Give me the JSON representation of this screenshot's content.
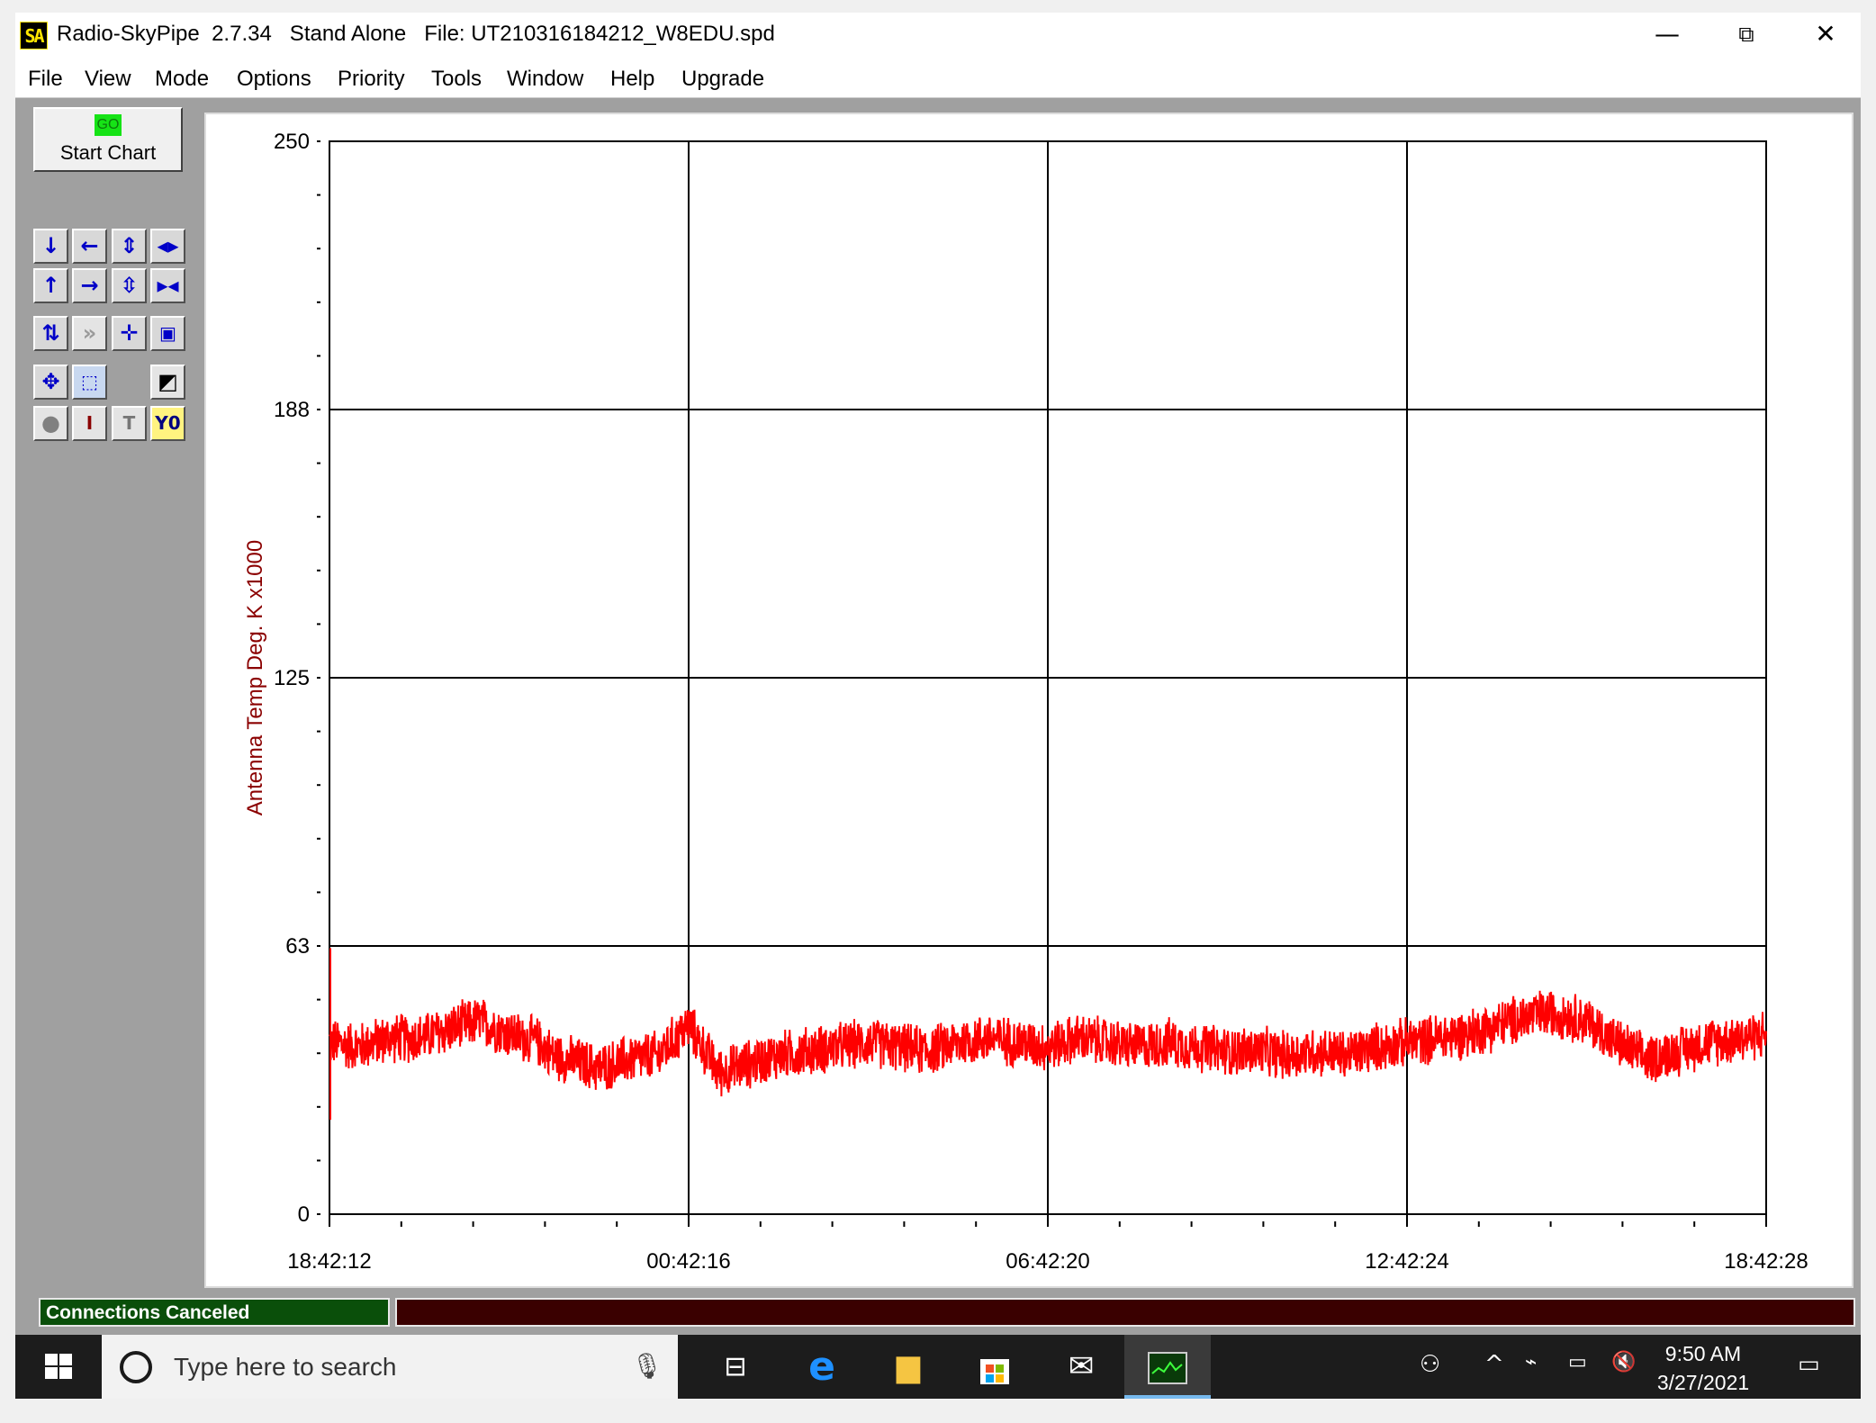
{
  "titlebar": {
    "icon_text": "SA",
    "title": "Radio-SkyPipe  2.7.34   Stand Alone   File: UT210316184212_W8EDU.spd",
    "minimize": "—",
    "restore": "⧉",
    "close": "✕"
  },
  "menu": [
    "File",
    "View",
    "Mode",
    "Options",
    "Priority",
    "Tools",
    "Window",
    "Help",
    "Upgrade"
  ],
  "start_button": {
    "go": "GO",
    "label": "Start Chart"
  },
  "toolbar": {
    "row1": [
      "arrow-down-icon",
      "arrow-left-icon",
      "expand-vertical-icon",
      "expand-horizontal-icon"
    ],
    "row2": [
      "arrow-up-icon",
      "arrow-right-icon",
      "compress-vertical-icon",
      "compress-horizontal-icon"
    ],
    "row3": [
      "refresh-icon",
      "fast-forward-icon",
      "crosshair-icon",
      "zoom-icon"
    ],
    "row4": [
      "move-icon",
      "select-area-icon",
      "measure-icon"
    ],
    "row5": [
      "record-icon",
      "info-icon",
      "text-icon"
    ],
    "y0_label": "Y0",
    "info_label": "I",
    "text_label": "T"
  },
  "status": {
    "left": "Connections Canceled",
    "right": ""
  },
  "taskbar": {
    "search_placeholder": "Type here to search",
    "time": "9:50 AM",
    "date": "3/27/2021"
  },
  "chart_data": {
    "type": "line",
    "title": "",
    "xlabel": "",
    "ylabel": "Antenna Temp Deg. K x1000",
    "ylim": [
      0,
      250
    ],
    "yticks": [
      "250",
      "188",
      "125",
      "63",
      "0"
    ],
    "xticks": [
      "18:42:12",
      "00:42:16",
      "06:42:20",
      "12:42:24",
      "18:42:28"
    ],
    "grid": true,
    "colors": {
      "series": "#ff0000",
      "ylabel": "#8b0000"
    },
    "series": [
      {
        "name": "",
        "x_hours": [
          0,
          1,
          2,
          3,
          4,
          5,
          6,
          7,
          7.5,
          8,
          8.5,
          9,
          10,
          11,
          12,
          13,
          14,
          15,
          16,
          17,
          18,
          19,
          20,
          21,
          22,
          23,
          24,
          25,
          26,
          27,
          28,
          29,
          30,
          31,
          32,
          33,
          34,
          35,
          36,
          37,
          38,
          39,
          40,
          41,
          42,
          43,
          44,
          45,
          46,
          47,
          48
        ],
        "values": [
          40,
          39,
          41,
          41,
          43,
          45,
          42,
          40,
          37,
          36,
          35,
          34,
          36,
          37,
          44,
          33,
          35,
          37,
          38,
          39,
          40,
          39,
          38,
          40,
          41,
          40,
          39,
          41,
          40,
          39,
          40,
          39,
          38,
          38,
          37,
          38,
          37,
          39,
          40,
          41,
          42,
          44,
          46,
          47,
          45,
          40,
          36,
          38,
          40,
          41,
          42
        ],
        "noise_amplitude": 4
      }
    ]
  }
}
